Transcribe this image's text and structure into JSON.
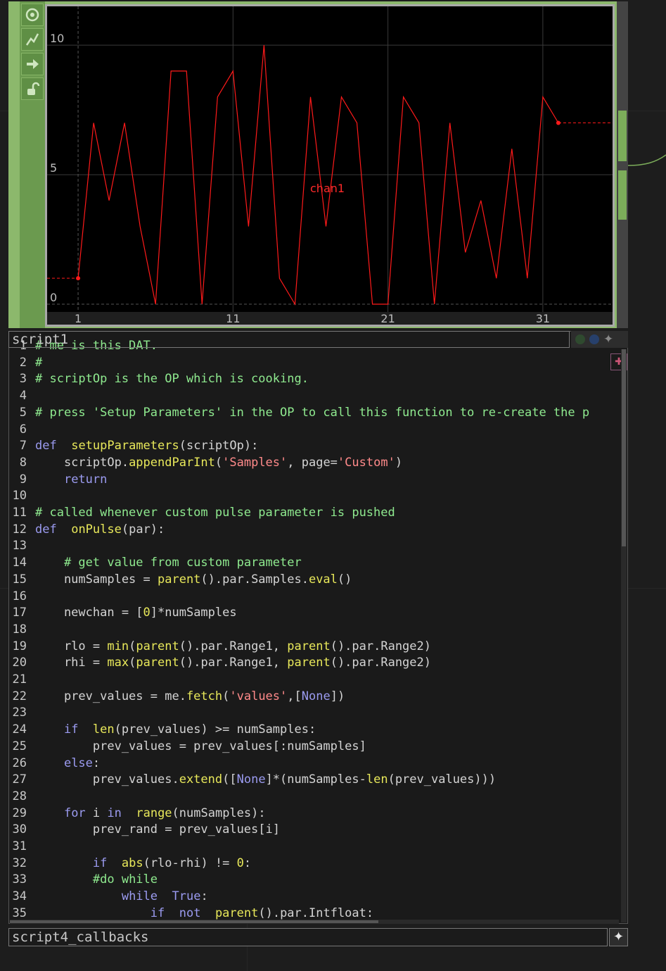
{
  "chop": {
    "channel_label": "chan1",
    "y_ticks": [
      "10",
      "5",
      "0"
    ],
    "x_ticks": [
      "1",
      "11",
      "21",
      "31"
    ]
  },
  "chart_data": {
    "type": "line",
    "series": [
      {
        "name": "chan1",
        "x": [
          1,
          2,
          3,
          4,
          5,
          6,
          7,
          8,
          9,
          10,
          11,
          12,
          13,
          14,
          15,
          16,
          17,
          18,
          19,
          20,
          21,
          22,
          23,
          24,
          25,
          26,
          27,
          28,
          29,
          30,
          31,
          32
        ],
        "values": [
          1,
          7,
          4,
          7,
          3,
          0,
          9,
          9,
          0,
          8,
          9,
          3,
          10,
          1,
          0,
          8,
          3,
          8,
          7,
          0,
          0,
          8,
          7,
          0,
          7,
          2,
          4,
          1,
          6,
          1,
          8,
          7
        ]
      }
    ],
    "ylim": [
      -0.3,
      11.5
    ],
    "xlim": [
      -1,
      35.5
    ],
    "colors": {
      "line": "#ff1a1a",
      "background": "#000000"
    }
  },
  "dat": {
    "title": "script1",
    "lines": [
      [
        [
          "cm",
          "# me is this DAT."
        ]
      ],
      [
        [
          "cm",
          "#"
        ]
      ],
      [
        [
          "cm",
          "# scriptOp is the OP which is cooking."
        ]
      ],
      [],
      [
        [
          "cm",
          "# press 'Setup Parameters' in the OP to call this function to re-create the p"
        ]
      ],
      [],
      [
        [
          "kw",
          "def"
        ],
        [
          "",
          "  "
        ],
        [
          "fn",
          "setupParameters"
        ],
        [
          "",
          "(scriptOp):"
        ]
      ],
      [
        [
          "",
          "    scriptOp."
        ],
        [
          "fn",
          "appendParInt"
        ],
        [
          "",
          "("
        ],
        [
          "st",
          "'Samples'"
        ],
        [
          "",
          ", page="
        ],
        [
          "st",
          "'Custom'"
        ],
        [
          "",
          ")"
        ]
      ],
      [
        [
          "",
          "    "
        ],
        [
          "kw",
          "return"
        ]
      ],
      [],
      [
        [
          "cm",
          "# called whenever custom pulse parameter is pushed"
        ]
      ],
      [
        [
          "kw",
          "def"
        ],
        [
          "",
          "  "
        ],
        [
          "fn",
          "onPulse"
        ],
        [
          "",
          "(par):"
        ]
      ],
      [],
      [
        [
          "",
          "    "
        ],
        [
          "cm",
          "# get value from custom parameter"
        ]
      ],
      [
        [
          "",
          "    numSamples = "
        ],
        [
          "fn",
          "parent"
        ],
        [
          "",
          "().par.Samples."
        ],
        [
          "fn",
          "eval"
        ],
        [
          "",
          "()"
        ]
      ],
      [],
      [
        [
          "",
          "    newchan = ["
        ],
        [
          "fn",
          "0"
        ],
        [
          "",
          "]*numSamples"
        ]
      ],
      [],
      [
        [
          "",
          "    rlo = "
        ],
        [
          "fn",
          "min"
        ],
        [
          "",
          "("
        ],
        [
          "fn",
          "parent"
        ],
        [
          "",
          "().par.Range1, "
        ],
        [
          "fn",
          "parent"
        ],
        [
          "",
          "().par.Range2)"
        ]
      ],
      [
        [
          "",
          "    rhi = "
        ],
        [
          "fn",
          "max"
        ],
        [
          "",
          "("
        ],
        [
          "fn",
          "parent"
        ],
        [
          "",
          "().par.Range1, "
        ],
        [
          "fn",
          "parent"
        ],
        [
          "",
          "().par.Range2)"
        ]
      ],
      [],
      [
        [
          "",
          "    prev_values = me."
        ],
        [
          "fn",
          "fetch"
        ],
        [
          "",
          "("
        ],
        [
          "st",
          "'values'"
        ],
        [
          "",
          ",["
        ],
        [
          "kw",
          "None"
        ],
        [
          "",
          "])"
        ]
      ],
      [],
      [
        [
          "",
          "    "
        ],
        [
          "kw",
          "if"
        ],
        [
          "",
          "  "
        ],
        [
          "fn",
          "len"
        ],
        [
          "",
          "(prev_values) >= numSamples:"
        ]
      ],
      [
        [
          "",
          "        prev_values = prev_values[:numSamples]"
        ]
      ],
      [
        [
          "",
          "    "
        ],
        [
          "kw",
          "else"
        ],
        [
          "",
          ":"
        ]
      ],
      [
        [
          "",
          "        prev_values."
        ],
        [
          "fn",
          "extend"
        ],
        [
          "",
          "(["
        ],
        [
          "kw",
          "None"
        ],
        [
          "",
          "]*(numSamples-"
        ],
        [
          "fn",
          "len"
        ],
        [
          "",
          "(prev_values)))"
        ]
      ],
      [],
      [
        [
          "",
          "    "
        ],
        [
          "kw",
          "for"
        ],
        [
          "",
          " i "
        ],
        [
          "kw",
          "in"
        ],
        [
          "",
          "  "
        ],
        [
          "fn",
          "range"
        ],
        [
          "",
          "(numSamples):"
        ]
      ],
      [
        [
          "",
          "        prev_rand = prev_values[i]"
        ]
      ],
      [],
      [
        [
          "",
          "        "
        ],
        [
          "kw",
          "if"
        ],
        [
          "",
          "  "
        ],
        [
          "fn",
          "abs"
        ],
        [
          "",
          "(rlo-rhi) != "
        ],
        [
          "fn",
          "0"
        ],
        [
          "",
          ":"
        ]
      ],
      [
        [
          "",
          "        "
        ],
        [
          "cm",
          "#do while"
        ]
      ],
      [
        [
          "",
          "            "
        ],
        [
          "kw",
          "while"
        ],
        [
          "",
          "  "
        ],
        [
          "kw",
          "True"
        ],
        [
          "",
          ":"
        ]
      ],
      [
        [
          "",
          "                "
        ],
        [
          "kw",
          "if"
        ],
        [
          "",
          "  "
        ],
        [
          "kw",
          "not"
        ],
        [
          "",
          "  "
        ],
        [
          "fn",
          "parent"
        ],
        [
          "",
          "().par.Intfloat:"
        ]
      ]
    ]
  },
  "bottom_node": {
    "title": "script4_callbacks"
  },
  "icons": {
    "star": "✦",
    "pin": "✚"
  }
}
